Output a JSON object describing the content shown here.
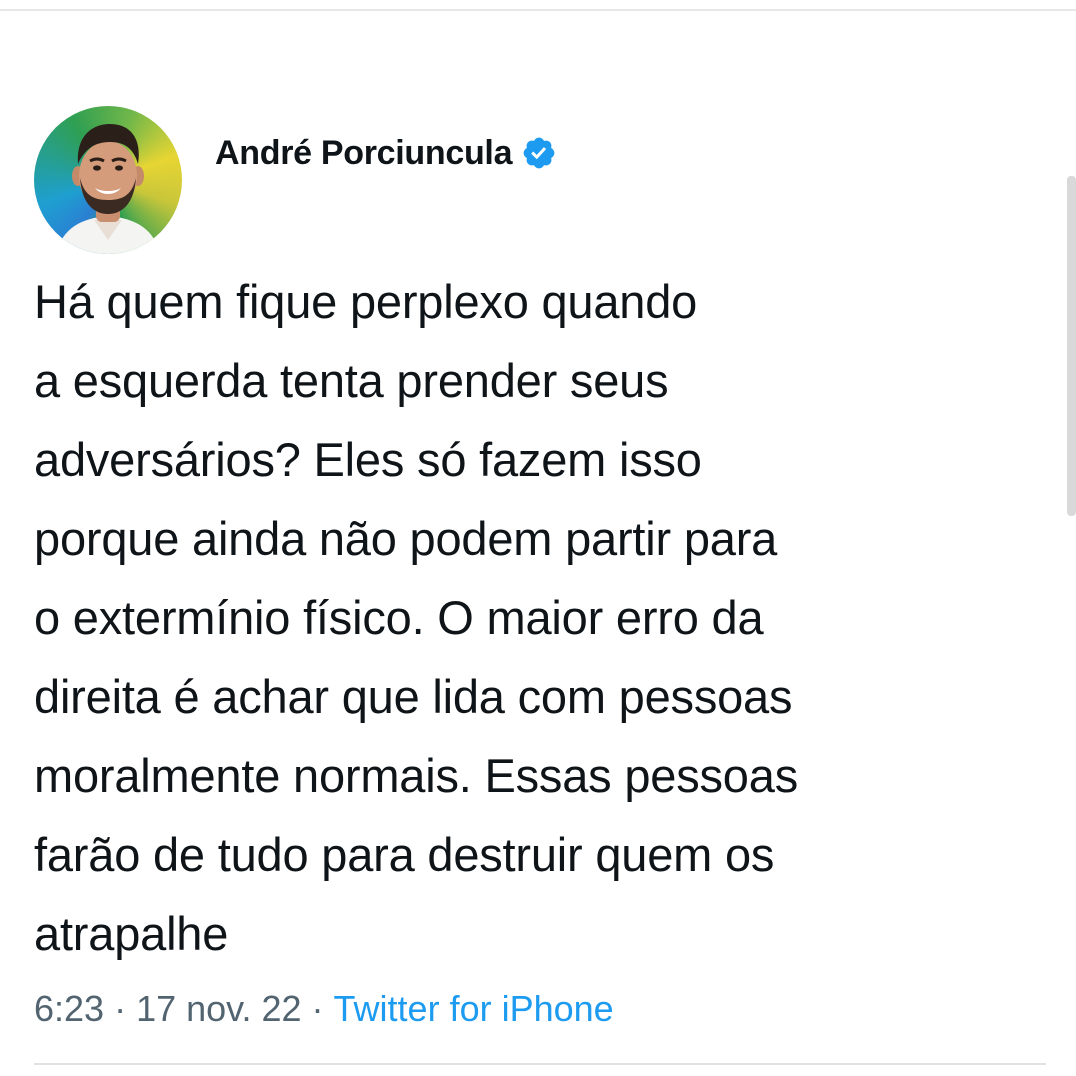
{
  "tweet": {
    "author": {
      "display_name": "André Porciuncula",
      "verified": true,
      "avatar_icon": "profile-photo",
      "verified_icon": "verified-badge-icon"
    },
    "text": "Há quem fique perplexo quando\na esquerda tenta prender seus\nadversários? Eles só fazem isso\nporque ainda não podem partir para\no extermínio físico. O maior erro da\ndireita é achar que lida com pessoas\nmoralmente normais. Essas pessoas\nfarão de tudo para destruir quem os\natrapalhe",
    "time": "6:23",
    "separator": "·",
    "date": "17 nov. 22",
    "source": "Twitter for iPhone"
  },
  "colors": {
    "text_primary": "#0f1419",
    "text_secondary": "#536471",
    "link": "#1d9bf0",
    "verified_badge": "#1d9bf0"
  }
}
